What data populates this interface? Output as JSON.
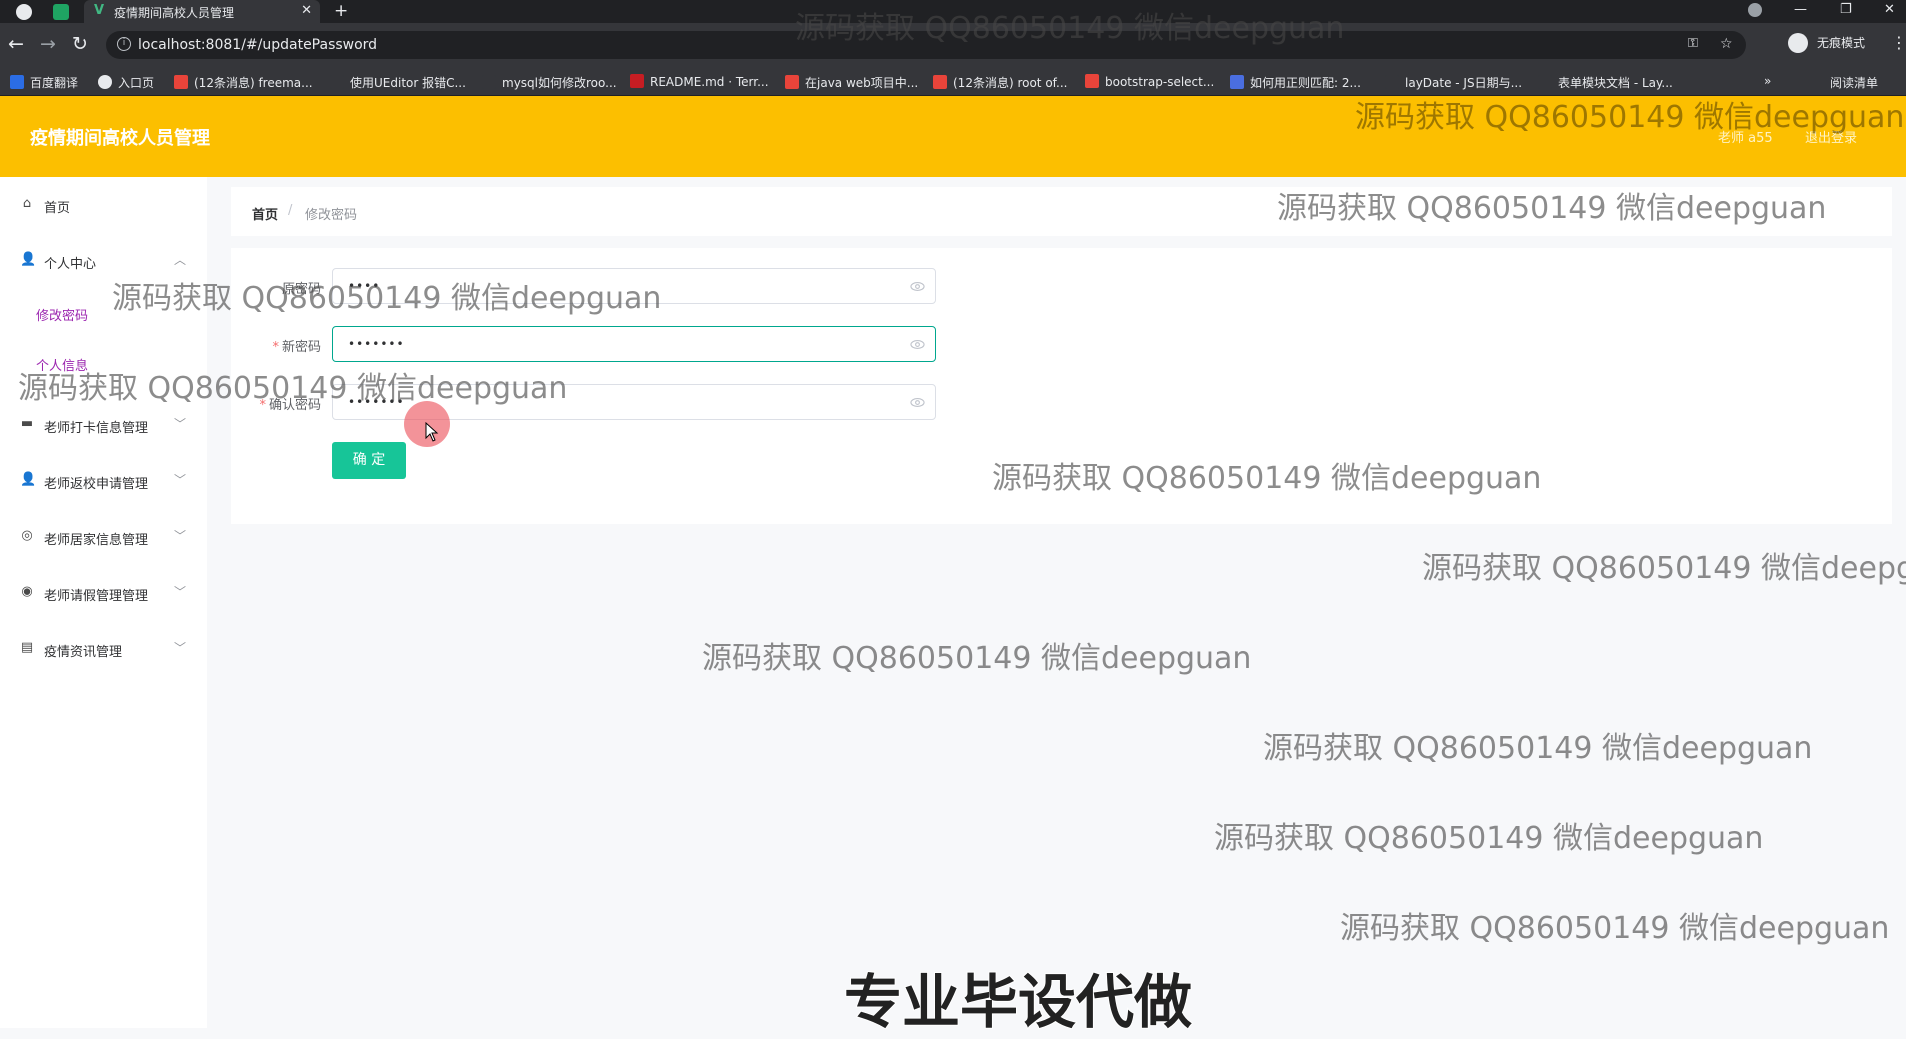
{
  "browser": {
    "tab_title": "疫情期间高校人员管理",
    "new_tab": "+",
    "url": "localhost:8081/#/updatePassword",
    "incognito_label": "无痕模式",
    "bookmarks": [
      {
        "label": "百度翻译",
        "color": "#2b6de5"
      },
      {
        "label": "入口页",
        "color": "#e8eaed"
      },
      {
        "label": "(12条消息) freema...",
        "color": "#e8443a"
      },
      {
        "label": "使用UEditor 报错C...",
        "color": "#35363a"
      },
      {
        "label": "mysql如何修改roo...",
        "color": "#35363a"
      },
      {
        "label": "README.md · Terr...",
        "color": "#c71d23"
      },
      {
        "label": "在java web项目中...",
        "color": "#e8443a"
      },
      {
        "label": "(12条消息) root of...",
        "color": "#e8443a"
      },
      {
        "label": "bootstrap-select...",
        "color": "#e8443a"
      },
      {
        "label": "如何用正则匹配: 2...",
        "color": "#4a6ee0"
      },
      {
        "label": "layDate - JS日期与...",
        "color": "#35363a"
      },
      {
        "label": "表单模块文档 - Lay...",
        "color": "#35363a"
      }
    ],
    "reading_list": "阅读清单"
  },
  "header": {
    "title": "疫情期间高校人员管理",
    "user": "老师 a55",
    "logout": "退出登录",
    "bg_color": "#fcbf00"
  },
  "sidebar": {
    "items": [
      {
        "label": "首页",
        "icon": "home-icon"
      },
      {
        "label": "个人中心",
        "icon": "user-icon",
        "expanded": true,
        "children": [
          "修改密码",
          "个人信息"
        ]
      },
      {
        "label": "老师打卡信息管理",
        "icon": "briefcase-icon"
      },
      {
        "label": "老师返校申请管理",
        "icon": "user-icon"
      },
      {
        "label": "老师居家信息管理",
        "icon": "globe-icon"
      },
      {
        "label": "老师请假管理管理",
        "icon": "compass-icon"
      },
      {
        "label": "疫情资讯管理",
        "icon": "news-icon"
      }
    ]
  },
  "breadcrumb": {
    "home": "首页",
    "separator": "/",
    "current": "修改密码"
  },
  "form": {
    "fields": [
      {
        "label": "原密码",
        "required": false,
        "value": "••••",
        "type": "password"
      },
      {
        "label": "新密码",
        "required": true,
        "value": "•••••••",
        "type": "password",
        "focused": true
      },
      {
        "label": "确认密码",
        "required": true,
        "value": "•••••••",
        "type": "password"
      }
    ],
    "submit_label": "确 定",
    "accent_color": "#17c598"
  },
  "watermarks": {
    "text": "源码获取 QQ86050149 微信deepguan",
    "text_truncated": "源码获取 QQ86050149 微信deepg",
    "caption": "专业毕设代做"
  }
}
